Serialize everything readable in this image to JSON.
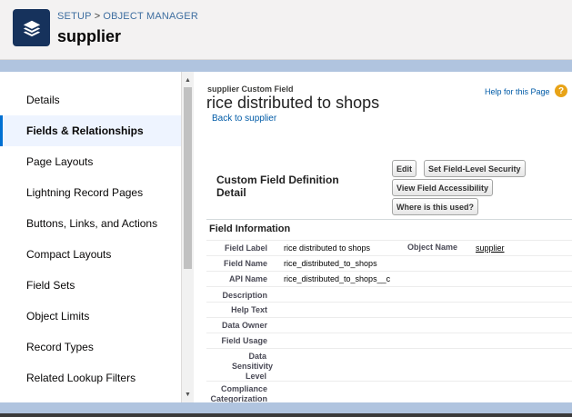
{
  "header": {
    "breadcrumb": [
      "SETUP",
      "OBJECT MANAGER"
    ],
    "breadcrumb_separator": ">",
    "title": "supplier",
    "icon": "layers-icon",
    "icon_bg": "#16325c"
  },
  "sidebar": {
    "items": [
      {
        "label": "Details",
        "active": false
      },
      {
        "label": "Fields & Relationships",
        "active": true
      },
      {
        "label": "Page Layouts",
        "active": false
      },
      {
        "label": "Lightning Record Pages",
        "active": false
      },
      {
        "label": "Buttons, Links, and Actions",
        "active": false
      },
      {
        "label": "Compact Layouts",
        "active": false
      },
      {
        "label": "Field Sets",
        "active": false
      },
      {
        "label": "Object Limits",
        "active": false
      },
      {
        "label": "Record Types",
        "active": false
      },
      {
        "label": "Related Lookup Filters",
        "active": false
      }
    ],
    "active_color": "#0070d2"
  },
  "content": {
    "object_label": "supplier Custom Field",
    "field_title": "rice distributed to shops",
    "back_link": "Back to supplier",
    "help_link": "Help for this Page",
    "help_icon": "question-icon",
    "section_title": "Custom Field Definition Detail",
    "buttons": {
      "edit": "Edit",
      "field_security": "Set Field-Level Security",
      "field_accessibility": "View Field Accessibility",
      "where_used": "Where is this used?"
    },
    "info_header": "Field Information",
    "fields": [
      {
        "label": "Field Label",
        "value": "rice distributed to shops",
        "label2": "Object Name",
        "value2": "supplier"
      },
      {
        "label": "Field Name",
        "value": "rice_distributed_to_shops"
      },
      {
        "label": "API Name",
        "value": "rice_distributed_to_shops__c"
      },
      {
        "label": "Description",
        "value": ""
      },
      {
        "label": "Help Text",
        "value": ""
      },
      {
        "label": "Data Owner",
        "value": ""
      },
      {
        "label": "Field Usage",
        "value": ""
      },
      {
        "label": "Data Sensitivity Level",
        "value": ""
      },
      {
        "label": "Compliance Categorization",
        "value": ""
      }
    ]
  }
}
